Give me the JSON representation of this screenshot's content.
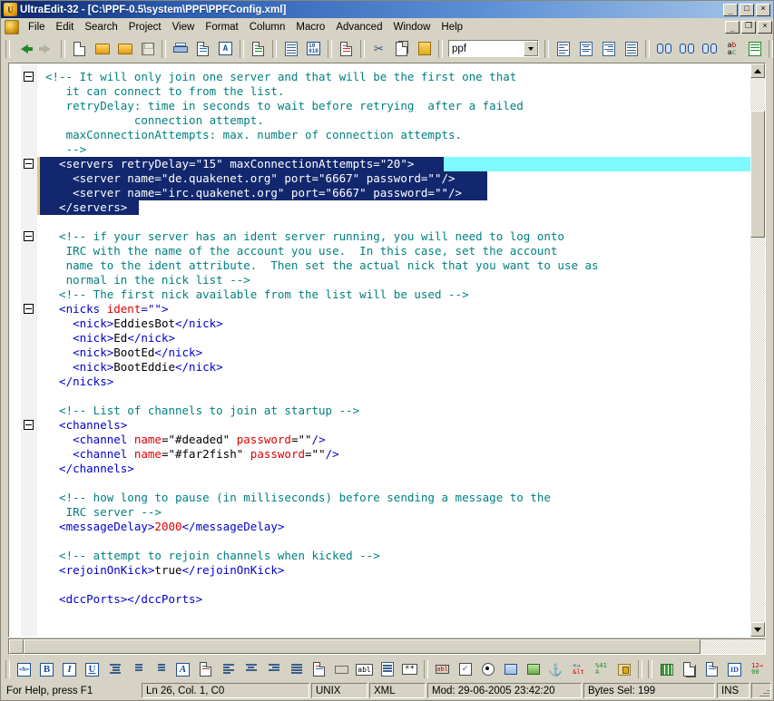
{
  "window": {
    "title": "UltraEdit-32 - [C:\\PPF-0.5\\system\\PPF\\PPFConfig.xml]",
    "app_icon": "ultraedit-icon",
    "minimize": "_",
    "maximize": "□",
    "close": "×"
  },
  "menu": {
    "items": [
      {
        "label": "File",
        "accel": "F"
      },
      {
        "label": "Edit",
        "accel": "E"
      },
      {
        "label": "Search",
        "accel": "S"
      },
      {
        "label": "Project",
        "accel": "P"
      },
      {
        "label": "View",
        "accel": "V"
      },
      {
        "label": "Format",
        "accel": "t"
      },
      {
        "label": "Column",
        "accel": "l"
      },
      {
        "label": "Macro",
        "accel": "M"
      },
      {
        "label": "Advanced",
        "accel": "A"
      },
      {
        "label": "Window",
        "accel": "W"
      },
      {
        "label": "Help",
        "accel": "H"
      }
    ],
    "doc_minimize": "_",
    "doc_restore": "❐",
    "doc_close": "×"
  },
  "toolbar": {
    "combo_value": "ppf",
    "buttons": [
      "back-icon",
      "forward-icon",
      "new-file-icon",
      "open-file-icon",
      "open-folder-icon",
      "save-icon",
      "print-icon",
      "print-preview-icon",
      "find-in-files-icon",
      "word-wrap-icon",
      "sort-icon",
      "hex-edit-icon",
      "column-mode-icon",
      "cut-icon",
      "copy-icon",
      "paste-icon",
      "align-left-icon",
      "align-center-icon",
      "align-right-icon",
      "align-justify-icon",
      "find-icon",
      "find-prev-icon",
      "find-next-icon",
      "replace-icon",
      "goto-line-icon",
      "tile-horizontal-icon",
      "tile-vertical-icon",
      "cascade-icon"
    ]
  },
  "bottom_toolbar": {
    "buttons": [
      "html-tag-icon",
      "bold-icon",
      "italic-icon",
      "underline-icon",
      "indent-icon",
      "bullet-list-icon",
      "numbered-list-icon",
      "font-color-icon",
      "highlight-icon",
      "align-left-tag-icon",
      "align-center-tag-icon",
      "align-right-tag-icon",
      "align-justify-tag-icon",
      "form-icon",
      "button-icon",
      "textbox-icon",
      "listbox-icon",
      "password-icon",
      "no-script-icon",
      "checkbox-icon",
      "radio-button-icon",
      "image-icon",
      "picture-icon",
      "anchor-icon",
      "special-char-icon",
      "entity-icon",
      "lock-icon",
      "table-icon",
      "copy-page-icon",
      "spellcheck-icon",
      "id-icon",
      "number-format-icon",
      "tools-icon"
    ]
  },
  "editor": {
    "fold_markers": 5,
    "selection_text": "<servers retryDelay=\"15\" maxConnectionAttempts=\"20\">\n    <server name=\"de.quakenet.org\" port=\"6667\" password=\"\"/>\n    <server name=\"irc.quakenet.org\" port=\"6667\" password=\"\"/>\n  </servers>",
    "colors": {
      "comment": "#008080",
      "tag": "#0000cf",
      "attribute": "#e00000",
      "text": "#000000",
      "selection_bg": "#12276e",
      "selection_fg": "#ffffff",
      "current_line_bg": "#7df9ff",
      "modified_marker": "#e8c477",
      "background": "#ffffff"
    },
    "lines": [
      {
        "indent": 0,
        "selected": false,
        "spans": [
          {
            "c": "com",
            "t": "<!-- It will only join one server and that will be the first one that"
          }
        ]
      },
      {
        "indent": 0,
        "selected": false,
        "spans": [
          {
            "c": "com",
            "t": "   it can connect to from the list."
          }
        ]
      },
      {
        "indent": 0,
        "selected": false,
        "spans": [
          {
            "c": "com",
            "t": "   retryDelay: time in seconds to wait before retrying  after a failed"
          }
        ]
      },
      {
        "indent": 0,
        "selected": false,
        "spans": [
          {
            "c": "com",
            "t": "             connection attempt."
          }
        ]
      },
      {
        "indent": 0,
        "selected": false,
        "spans": [
          {
            "c": "com",
            "t": "   maxConnectionAttempts: max. number of connection attempts."
          }
        ]
      },
      {
        "indent": 0,
        "selected": false,
        "spans": [
          {
            "c": "com",
            "t": "   -->"
          }
        ]
      },
      {
        "indent": 0,
        "selected": true,
        "cur": true,
        "selwidth": 448,
        "spans": [
          {
            "c": "txt",
            "t": "  <servers retryDelay=\"15\" maxConnectionAttempts=\"20\">"
          }
        ]
      },
      {
        "indent": 0,
        "selected": true,
        "selwidth": 496,
        "spans": [
          {
            "c": "txt",
            "t": "    <server name=\"de.quakenet.org\" port=\"6667\" password=\"\"/>"
          }
        ]
      },
      {
        "indent": 0,
        "selected": true,
        "selwidth": 496,
        "spans": [
          {
            "c": "txt",
            "t": "    <server name=\"irc.quakenet.org\" port=\"6667\" password=\"\"/>"
          }
        ]
      },
      {
        "indent": 0,
        "selected": true,
        "selwidth": 112,
        "spans": [
          {
            "c": "txt",
            "t": "  </servers>"
          }
        ]
      },
      {
        "indent": 0,
        "selected": false,
        "spans": []
      },
      {
        "indent": 0,
        "selected": false,
        "spans": [
          {
            "c": "com",
            "t": "  <!-- if your server has an ident server running, you will need to log onto"
          }
        ]
      },
      {
        "indent": 0,
        "selected": false,
        "spans": [
          {
            "c": "com",
            "t": "   IRC with the name of the account you use.  In this case, set the account"
          }
        ]
      },
      {
        "indent": 0,
        "selected": false,
        "spans": [
          {
            "c": "com",
            "t": "   name to the ident attribute.  Then set the actual nick that you want to use as"
          }
        ]
      },
      {
        "indent": 0,
        "selected": false,
        "spans": [
          {
            "c": "com",
            "t": "   normal in the nick list -->"
          }
        ]
      },
      {
        "indent": 0,
        "selected": false,
        "spans": [
          {
            "c": "com",
            "t": "  <!-- The first nick available from the list will be used -->"
          }
        ]
      },
      {
        "indent": 0,
        "selected": false,
        "spans": [
          {
            "c": "tag",
            "t": "  <nicks "
          },
          {
            "c": "att",
            "t": "ident"
          },
          {
            "c": "tag",
            "t": "=\"\">"
          }
        ]
      },
      {
        "indent": 0,
        "selected": false,
        "spans": [
          {
            "c": "tag",
            "t": "    <nick>"
          },
          {
            "c": "txt",
            "t": "EddiesBot"
          },
          {
            "c": "tag",
            "t": "</nick>"
          }
        ]
      },
      {
        "indent": 0,
        "selected": false,
        "spans": [
          {
            "c": "tag",
            "t": "    <nick>"
          },
          {
            "c": "txt",
            "t": "Ed"
          },
          {
            "c": "tag",
            "t": "</nick>"
          }
        ]
      },
      {
        "indent": 0,
        "selected": false,
        "spans": [
          {
            "c": "tag",
            "t": "    <nick>"
          },
          {
            "c": "txt",
            "t": "BootEd"
          },
          {
            "c": "tag",
            "t": "</nick>"
          }
        ]
      },
      {
        "indent": 0,
        "selected": false,
        "spans": [
          {
            "c": "tag",
            "t": "    <nick>"
          },
          {
            "c": "txt",
            "t": "BootEddie"
          },
          {
            "c": "tag",
            "t": "</nick>"
          }
        ]
      },
      {
        "indent": 0,
        "selected": false,
        "spans": [
          {
            "c": "tag",
            "t": "  </nicks>"
          }
        ]
      },
      {
        "indent": 0,
        "selected": false,
        "spans": []
      },
      {
        "indent": 0,
        "selected": false,
        "spans": [
          {
            "c": "com",
            "t": "  <!-- List of channels to join at startup -->"
          }
        ]
      },
      {
        "indent": 0,
        "selected": false,
        "spans": [
          {
            "c": "tag",
            "t": "  <channels>"
          }
        ]
      },
      {
        "indent": 0,
        "selected": false,
        "spans": [
          {
            "c": "tag",
            "t": "    <channel "
          },
          {
            "c": "att",
            "t": "name"
          },
          {
            "c": "txt",
            "t": "=\"#deaded\" "
          },
          {
            "c": "att",
            "t": "password"
          },
          {
            "c": "txt",
            "t": "=\"\""
          },
          {
            "c": "tag",
            "t": "/>"
          }
        ]
      },
      {
        "indent": 0,
        "selected": false,
        "spans": [
          {
            "c": "tag",
            "t": "    <channel "
          },
          {
            "c": "att",
            "t": "name"
          },
          {
            "c": "txt",
            "t": "=\"#far2fish\" "
          },
          {
            "c": "att",
            "t": "password"
          },
          {
            "c": "txt",
            "t": "=\"\""
          },
          {
            "c": "tag",
            "t": "/>"
          }
        ]
      },
      {
        "indent": 0,
        "selected": false,
        "spans": [
          {
            "c": "tag",
            "t": "  </channels>"
          }
        ]
      },
      {
        "indent": 0,
        "selected": false,
        "spans": []
      },
      {
        "indent": 0,
        "selected": false,
        "spans": [
          {
            "c": "com",
            "t": "  <!-- how long to pause (in milliseconds) before sending a message to the"
          }
        ]
      },
      {
        "indent": 0,
        "selected": false,
        "spans": [
          {
            "c": "com",
            "t": "   IRC server -->"
          }
        ]
      },
      {
        "indent": 0,
        "selected": false,
        "spans": [
          {
            "c": "tag",
            "t": "  <messageDelay>"
          },
          {
            "c": "num",
            "t": "2000"
          },
          {
            "c": "tag",
            "t": "</messageDelay>"
          }
        ]
      },
      {
        "indent": 0,
        "selected": false,
        "spans": []
      },
      {
        "indent": 0,
        "selected": false,
        "spans": [
          {
            "c": "com",
            "t": "  <!-- attempt to rejoin channels when kicked -->"
          }
        ]
      },
      {
        "indent": 0,
        "selected": false,
        "spans": [
          {
            "c": "tag",
            "t": "  <rejoinOnKick>"
          },
          {
            "c": "txt",
            "t": "true"
          },
          {
            "c": "tag",
            "t": "</rejoinOnKick>"
          }
        ]
      },
      {
        "indent": 0,
        "selected": false,
        "spans": []
      },
      {
        "indent": 0,
        "selected": false,
        "spans": [
          {
            "c": "tag",
            "t": "  <dccPorts></dccPorts>"
          }
        ]
      }
    ]
  },
  "statusbar": {
    "help": "For Help, press F1",
    "position": "Ln 26, Col. 1, C0",
    "line_ending": "UNIX",
    "syntax": "XML",
    "modified": "Mod: 29-06-2005 23:42:20",
    "bytes_selected": "Bytes Sel: 199",
    "insert_mode": "INS"
  }
}
